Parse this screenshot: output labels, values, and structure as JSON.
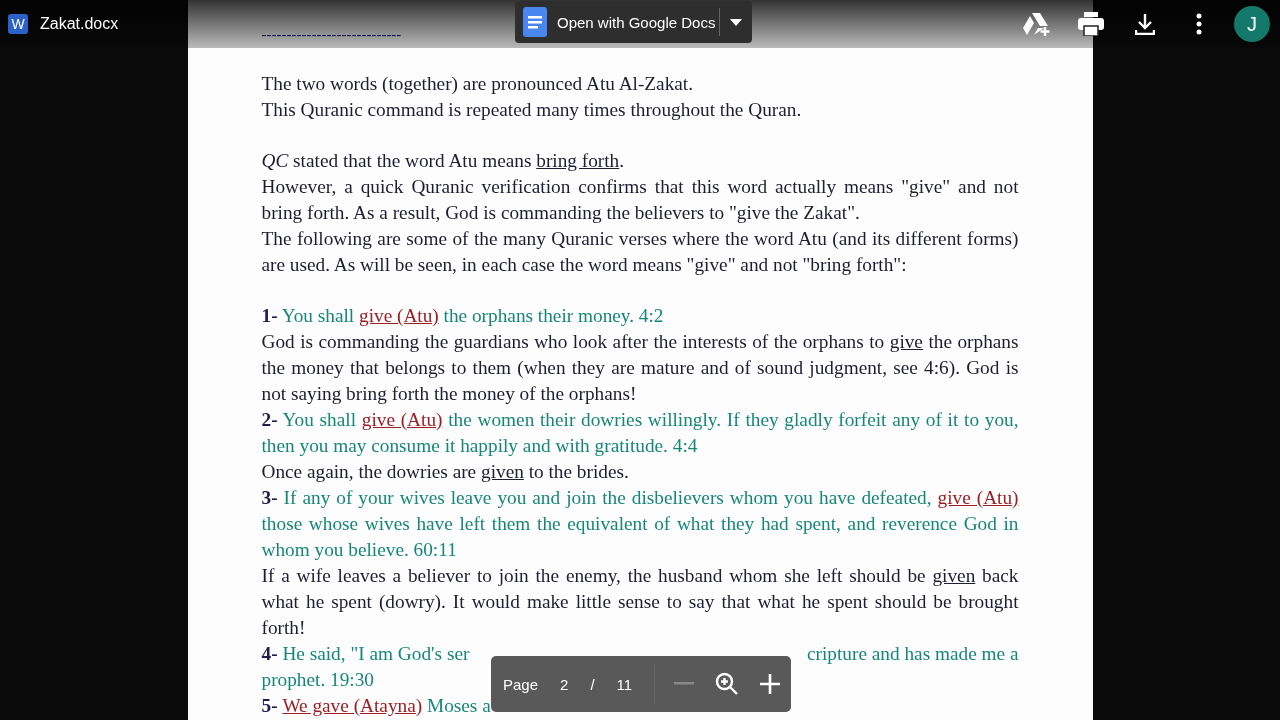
{
  "top_bar": {
    "file_name": "Zakat.docx",
    "app_letter": "W",
    "open_button": "Open with Google Docs",
    "avatar_letter": "J"
  },
  "document": {
    "separator": "----------------------------",
    "groups": [
      [
        [
          {
            "kind": "text",
            "text": "The two words (together) are pronounced Atu Al-Zakat."
          }
        ],
        [
          {
            "kind": "text",
            "text": "This Quranic command is repeated many times throughout the Quran."
          }
        ]
      ],
      [
        [
          {
            "kind": "italic",
            "text": "QC"
          },
          {
            "kind": "text",
            "text": " stated that the word Atu means "
          },
          {
            "kind": "underline",
            "text": "bring forth"
          },
          {
            "kind": "text",
            "text": "."
          }
        ],
        [
          {
            "kind": "text",
            "text": "However, a quick Quranic verification confirms that this word actually means \"give\" and not bring forth. As a result, God is commanding the believers to \"give the Zakat\"."
          }
        ],
        [
          {
            "kind": "text",
            "text": "The following are some of the many Quranic verses where the word Atu (and its different forms) are used. As will be seen, in each case the word means \"give\" and not \"bring forth\":"
          }
        ]
      ],
      [
        [
          {
            "kind": "number",
            "text": "1-"
          },
          {
            "kind": "verse",
            "text": " You shall "
          },
          {
            "kind": "quote",
            "text": "give (Atu)"
          },
          {
            "kind": "verse",
            "text": " the orphans their money. 4:2"
          }
        ],
        [
          {
            "kind": "text",
            "text": "God is commanding the guardians who look after the interests of the orphans to "
          },
          {
            "kind": "underline",
            "text": "give"
          },
          {
            "kind": "text",
            "text": " the orphans the money that belongs to them (when they are mature and of sound judgment, see 4:6). God is not saying bring forth the money of the orphans!"
          }
        ],
        [
          {
            "kind": "number",
            "text": "2-"
          },
          {
            "kind": "verse",
            "text": " You shall "
          },
          {
            "kind": "quote",
            "text": "give (Atu)"
          },
          {
            "kind": "verse",
            "text": " the women their dowries willingly. If they gladly forfeit any of it to you, then you may consume it happily and with gratitude. 4:4"
          }
        ],
        [
          {
            "kind": "text",
            "text": "Once again, the dowries are "
          },
          {
            "kind": "underline",
            "text": "given"
          },
          {
            "kind": "text",
            "text": " to the brides."
          }
        ],
        [
          {
            "kind": "number",
            "text": "3-"
          },
          {
            "kind": "verse",
            "text": " If any of your wives leave you and join the disbelievers whom you have defeated, "
          },
          {
            "kind": "quote",
            "text": "give (Atu)"
          },
          {
            "kind": "verse",
            "text": " those whose wives have left them the equivalent of what they had spent, and reverence God in whom you believe. 60:11"
          }
        ],
        [
          {
            "kind": "text",
            "text": "If a wife leaves a believer to join the enemy, the husband whom she left should be "
          },
          {
            "kind": "underline",
            "text": "given"
          },
          {
            "kind": "text",
            "text": " back what he spent (dowry). It would make little sense to say that what he spent should be brought forth!"
          }
        ]
      ]
    ],
    "covered_lines": [
      {
        "left": [
          {
            "kind": "number",
            "text": "4-"
          },
          {
            "kind": "verse",
            "text": " He said, \"I am God's ser"
          }
        ],
        "right": [
          {
            "kind": "verse",
            "text": "cripture and has made me a"
          }
        ]
      },
      {
        "left": [
          {
            "kind": "verse",
            "text": "prophet. 19:30"
          }
        ]
      },
      {
        "left": [
          {
            "kind": "number",
            "text": "5- "
          },
          {
            "kind": "quote",
            "text": "We gave (Atayna)"
          },
          {
            "kind": "verse",
            "text": " Moses a"
          }
        ]
      }
    ]
  },
  "page_control": {
    "label": "Page",
    "current": "2",
    "divider": "/",
    "total": "11"
  }
}
